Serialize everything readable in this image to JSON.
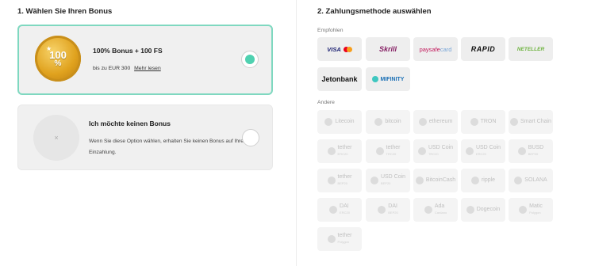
{
  "bonus_section": {
    "title": "1. Wählen Sie Ihren Bonus",
    "selected_option": {
      "badge_text": "100",
      "badge_symbol": "%",
      "title": "100% Bonus + 100 FS",
      "subtitle": "bis zu EUR 300",
      "link": "Mehr lesen"
    },
    "no_bonus_option": {
      "icon": "×",
      "title": "Ich möchte keinen Bonus",
      "description": "Wenn Sie diese Option wählen, erhalten Sie keinen Bonus auf Ihre Einzahlung."
    }
  },
  "payment_section": {
    "title": "2. Zahlungsmethode auswählen",
    "recommended_label": "Empfohlen",
    "other_label": "Andere",
    "recommended": [
      {
        "label": "VISA"
      },
      {
        "label": "Skrill"
      },
      {
        "label": "paysafe",
        "label2": "card"
      },
      {
        "label": "RAPID"
      },
      {
        "label": "NETELLER"
      },
      {
        "label": "Jetonbank"
      },
      {
        "label": "MIFINITY"
      }
    ],
    "other": [
      {
        "label": "Litecoin"
      },
      {
        "label": "bitcoin"
      },
      {
        "label": "ethereum"
      },
      {
        "label": "TRON"
      },
      {
        "label": "Smart Chain"
      },
      {
        "label": "tether",
        "sub": "ERC20"
      },
      {
        "label": "tether",
        "sub": "TRC20"
      },
      {
        "label": "USD Coin",
        "sub": "TRC20"
      },
      {
        "label": "USD Coin",
        "sub": "ERC20"
      },
      {
        "label": "BUSD",
        "sub": "BEP20"
      },
      {
        "label": "tether",
        "sub": "BEP20"
      },
      {
        "label": "USD Coin",
        "sub": "BEP20"
      },
      {
        "label": "BitcoinCash"
      },
      {
        "label": "ripple"
      },
      {
        "label": "SOLANA"
      },
      {
        "label": "DAI",
        "sub": "ERC20"
      },
      {
        "label": "DAI",
        "sub": "BEP20"
      },
      {
        "label": "Ada",
        "sub": "Cardano"
      },
      {
        "label": "Dogecoin"
      },
      {
        "label": "Matic",
        "sub": "Polygon"
      },
      {
        "label": "tether",
        "sub": "Polygon"
      }
    ]
  },
  "colors": {
    "accent": "#4fd1b0",
    "selected_border": "#7fd8c0",
    "card_bg": "#f0f0f0"
  }
}
